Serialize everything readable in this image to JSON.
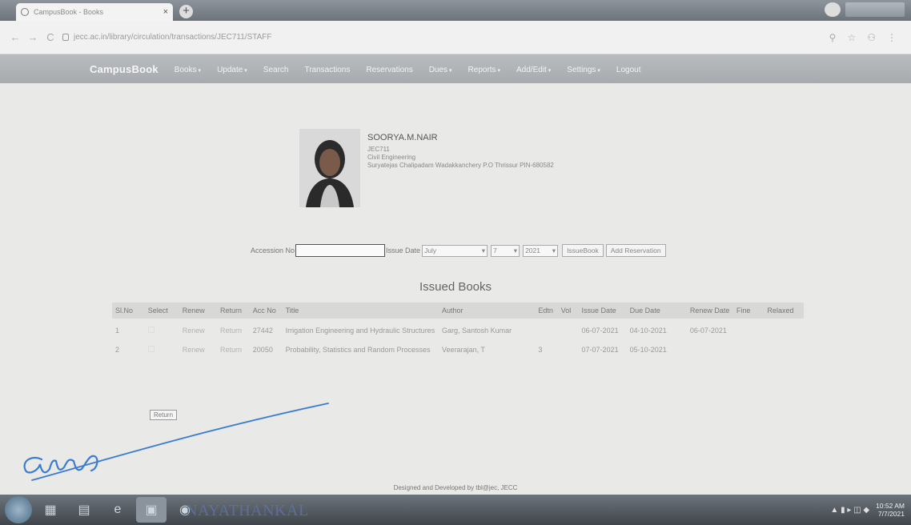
{
  "browser": {
    "tab_title": "CampusBook - Books",
    "new_tab": "+",
    "url": "jecc.ac.in/library/circulation/transactions/JEC711/STAFF"
  },
  "navbar": {
    "brand": "CampusBook",
    "items": [
      {
        "label": "Books",
        "caret": true
      },
      {
        "label": "Update",
        "caret": true
      },
      {
        "label": "Search",
        "caret": false
      },
      {
        "label": "Transactions",
        "caret": false
      },
      {
        "label": "Reservations",
        "caret": false
      },
      {
        "label": "Dues",
        "caret": true
      },
      {
        "label": "Reports",
        "caret": true
      },
      {
        "label": "Add/Edit",
        "caret": true
      },
      {
        "label": "Settings",
        "caret": true
      },
      {
        "label": "Logout",
        "caret": false
      }
    ]
  },
  "profile": {
    "name": "SOORYA.M.NAIR",
    "id": "JEC711",
    "department": "Civil Engineering",
    "address": "Suryatejas Chalipadam Wadakkanchery P.O Thrissur PIN-680582"
  },
  "issue_form": {
    "accession_label": "Accession No",
    "accession_value": "",
    "issue_date_label": "Issue Date",
    "month": "July",
    "day": "7",
    "year": "2021",
    "issue_button": "IssueBook",
    "reservation_button": "Add Reservation"
  },
  "issued_books": {
    "title": "Issued Books",
    "columns": [
      "Sl.No",
      "Select",
      "Renew",
      "Return",
      "Acc No",
      "Title",
      "Author",
      "Edtn",
      "Vol",
      "Issue Date",
      "Due Date",
      "Renew Date",
      "Fine",
      "Relaxed"
    ],
    "rows": [
      {
        "slno": "1",
        "renew": "Renew",
        "return": "Return",
        "acc": "27442",
        "title": "Irrigation Engineering and Hydraulic Structures",
        "author": "Garg, Santosh Kumar",
        "edtn": "",
        "vol": "",
        "issue": "06-07-2021",
        "due": "04-10-2021",
        "renewdate": "06-07-2021",
        "fine": "",
        "relaxed": ""
      },
      {
        "slno": "2",
        "renew": "Renew",
        "return": "Return",
        "acc": "20050",
        "title": "Probability, Statistics and Random Processes",
        "author": "Veerarajan, T",
        "edtn": "3",
        "vol": "",
        "issue": "07-07-2021",
        "due": "05-10-2021",
        "renewdate": "",
        "fine": "",
        "relaxed": ""
      }
    ],
    "return_button": "Return"
  },
  "footer": "Designed and Developed by tbl@jec, JECC",
  "taskbar": {
    "time": "10:52 AM",
    "date": "7/7/2021",
    "handwritten": "NAYATHANKAL"
  },
  "colors": {
    "navbar": "#afb3b6",
    "page_bg": "#e9e9e7",
    "signature_ink": "#3b7bd0"
  }
}
